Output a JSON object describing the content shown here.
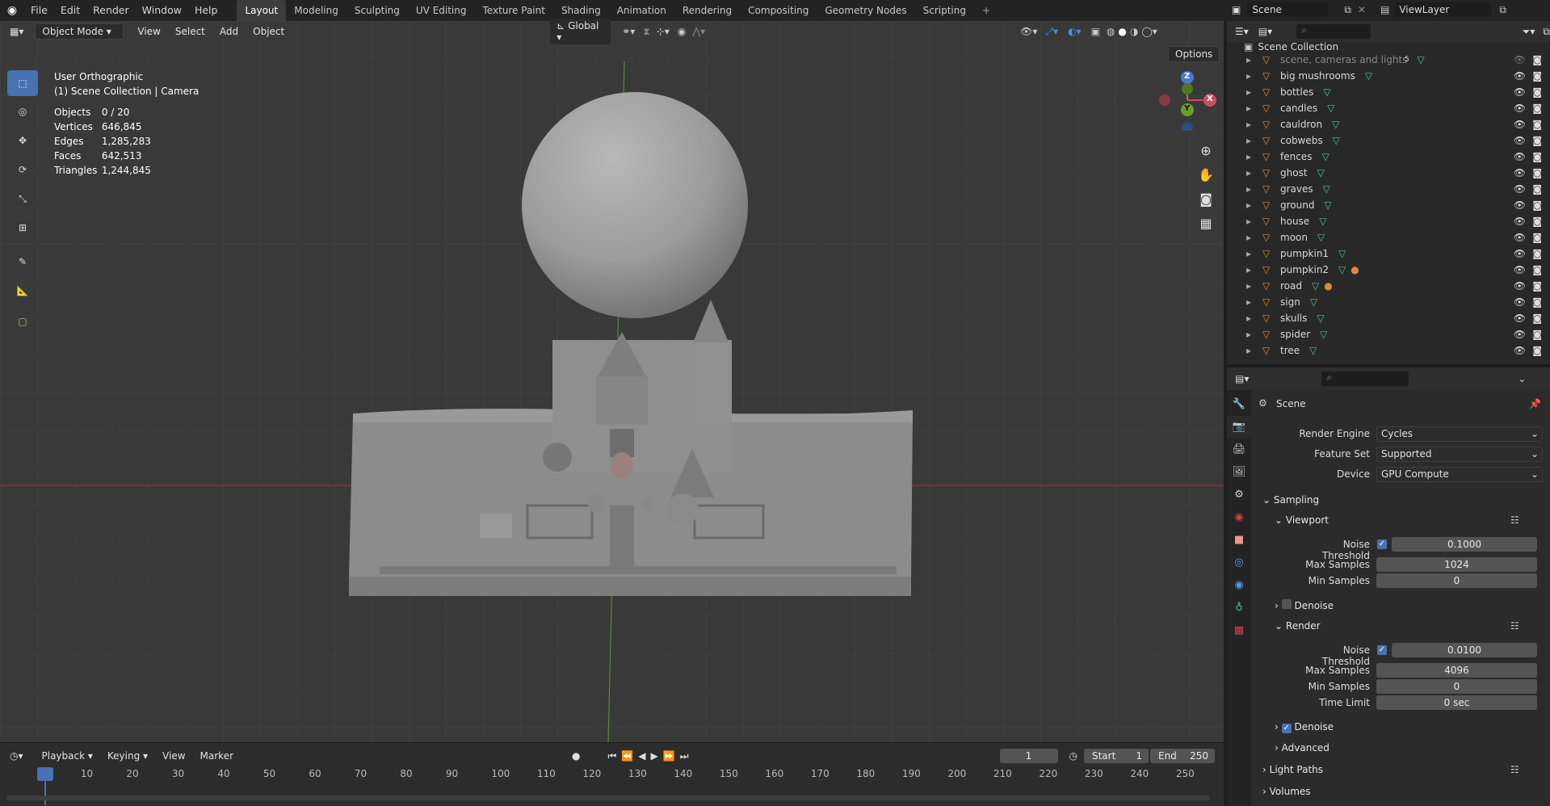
{
  "topbar": {
    "menus": [
      "File",
      "Edit",
      "Render",
      "Window",
      "Help"
    ],
    "workspaces": [
      "Layout",
      "Modeling",
      "Sculpting",
      "UV Editing",
      "Texture Paint",
      "Shading",
      "Animation",
      "Rendering",
      "Compositing",
      "Geometry Nodes",
      "Scripting"
    ],
    "active_workspace": "Layout",
    "scene_name": "Scene",
    "view_layer": "ViewLayer"
  },
  "viewport": {
    "mode": "Object Mode",
    "menus": [
      "View",
      "Select",
      "Add",
      "Object"
    ],
    "orientation": "Global",
    "options_label": "Options",
    "view_name": "User Orthographic",
    "collection_info": "(1) Scene Collection | Camera",
    "stats": [
      {
        "label": "Objects",
        "value": "0 / 20"
      },
      {
        "label": "Vertices",
        "value": "646,845"
      },
      {
        "label": "Edges",
        "value": "1,285,283"
      },
      {
        "label": "Faces",
        "value": "642,513"
      },
      {
        "label": "Triangles",
        "value": "1,244,845"
      }
    ],
    "gizmo_axes": [
      "Z",
      "Y",
      "X"
    ]
  },
  "outliner": {
    "root": "Scene Collection",
    "items": [
      "scene, cameras and lights",
      "big mushrooms",
      "bottles",
      "candles",
      "cauldron",
      "cobwebs",
      "fences",
      "ghost",
      "graves",
      "ground",
      "house",
      "moon",
      "pumpkin1",
      "pumpkin2",
      "road",
      "sign",
      "skulls",
      "spider",
      "tree"
    ],
    "scene_badge": "5"
  },
  "properties": {
    "title": "Scene",
    "render_engine_label": "Render Engine",
    "render_engine": "Cycles",
    "feature_set_label": "Feature Set",
    "feature_set": "Supported",
    "device_label": "Device",
    "device": "GPU Compute",
    "sampling": "Sampling",
    "viewport": "Viewport",
    "render": "Render",
    "noise_threshold_label": "Noise Threshold",
    "max_samples_label": "Max Samples",
    "min_samples_label": "Min Samples",
    "time_limit_label": "Time Limit",
    "viewport_noise": "0.1000",
    "viewport_max": "1024",
    "viewport_min": "0",
    "render_noise": "0.0100",
    "render_max": "4096",
    "render_min": "0",
    "time_limit": "0 sec",
    "denoise": "Denoise",
    "advanced": "Advanced",
    "light_paths": "Light Paths",
    "volumes": "Volumes"
  },
  "timeline": {
    "menus": [
      "Playback",
      "Keying",
      "View",
      "Marker"
    ],
    "current_frame": "1",
    "start_label": "Start",
    "start": "1",
    "end_label": "End",
    "end": "250",
    "ticks": [
      "1",
      "10",
      "20",
      "30",
      "40",
      "50",
      "60",
      "70",
      "80",
      "90",
      "100",
      "110",
      "120",
      "130",
      "140",
      "150",
      "160",
      "170",
      "180",
      "190",
      "200",
      "210",
      "220",
      "230",
      "240",
      "250"
    ]
  }
}
